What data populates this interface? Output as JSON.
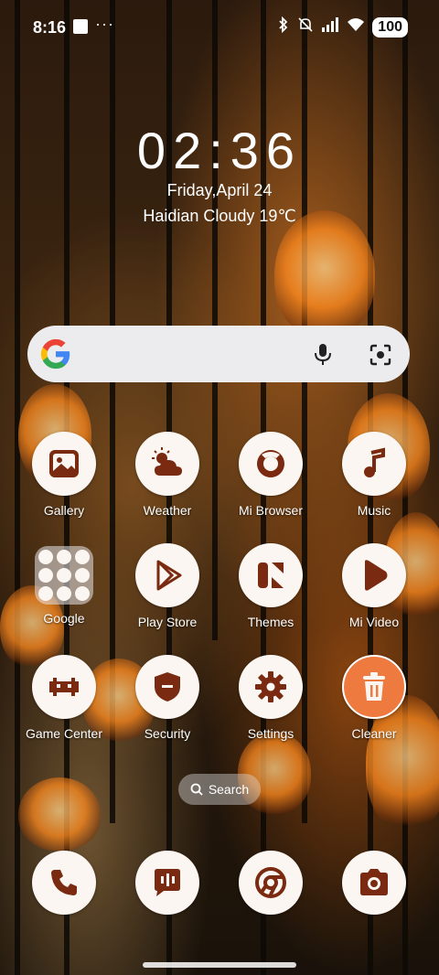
{
  "status_bar": {
    "time": "8:16",
    "dots": "···",
    "battery": "100"
  },
  "lock_widget": {
    "clock": "02:36",
    "date": "Friday,April 24",
    "weather": "Haidian Cloudy 19℃"
  },
  "search_widget": {
    "logo": "google-logo",
    "mic": "mic-icon",
    "lens": "lens-icon"
  },
  "apps": [
    {
      "label": "Gallery",
      "icon": "gallery-icon"
    },
    {
      "label": "Weather",
      "icon": "weather-icon"
    },
    {
      "label": "Mi Browser",
      "icon": "browser-icon"
    },
    {
      "label": "Music",
      "icon": "music-icon"
    },
    {
      "label": "Google",
      "icon": "folder-icon"
    },
    {
      "label": "Play Store",
      "icon": "play-store-icon"
    },
    {
      "label": "Themes",
      "icon": "themes-icon"
    },
    {
      "label": "Mi Video",
      "icon": "video-icon"
    },
    {
      "label": "Game Center",
      "icon": "game-icon"
    },
    {
      "label": "Security",
      "icon": "security-icon"
    },
    {
      "label": "Settings",
      "icon": "settings-icon"
    },
    {
      "label": "Cleaner",
      "icon": "cleaner-icon"
    }
  ],
  "drawer_search_label": "Search",
  "dock": [
    {
      "icon": "phone-icon"
    },
    {
      "icon": "messages-icon"
    },
    {
      "icon": "chrome-icon"
    },
    {
      "icon": "camera-icon"
    }
  ],
  "colors": {
    "icon_bg": "#fbf6f1",
    "icon_fg": "#7a2a10",
    "cleaner_bg": "#ef7a3f"
  }
}
